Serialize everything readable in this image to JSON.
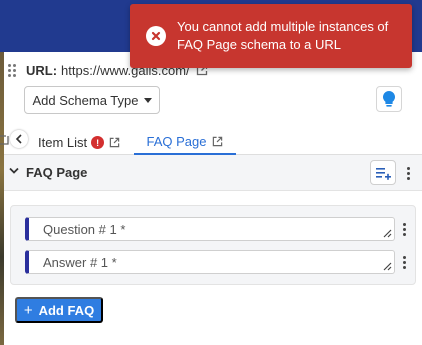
{
  "url_bar": {
    "label": "URL:",
    "value": "https://www.galls.com/"
  },
  "add_schema_button": {
    "label": "Add Schema Type"
  },
  "tabs": [
    {
      "label": "Item List",
      "has_error": true,
      "error_glyph": "!"
    },
    {
      "label": "FAQ Page",
      "active": true
    }
  ],
  "section": {
    "title": "FAQ Page"
  },
  "faq_fields": {
    "question_placeholder": "Question # 1 *",
    "answer_placeholder": "Answer # 1 *"
  },
  "add_faq_button": {
    "label": "Add FAQ",
    "icon": "+"
  },
  "toast": {
    "message": "You cannot add multiple instances of FAQ Page schema to a URL",
    "type": "error"
  },
  "colors": {
    "header_bar": "#213a8f",
    "toast_bg": "#c7362f",
    "active_tab": "#2a6fd6",
    "primary_button": "#2f7de1",
    "field_accent": "#2a2f9c",
    "error_badge": "#d32f2f",
    "bulb": "#1e88e5"
  },
  "icons": {
    "drag": "drag-handle-icon",
    "external": "external-link-icon",
    "bulb": "lightbulb-icon",
    "scroll_left": "chevron-left-icon",
    "collapse": "chevron-down-icon",
    "add_list": "playlist-add-icon",
    "more": "more-vertical-icon",
    "error": "close-circle-icon"
  }
}
